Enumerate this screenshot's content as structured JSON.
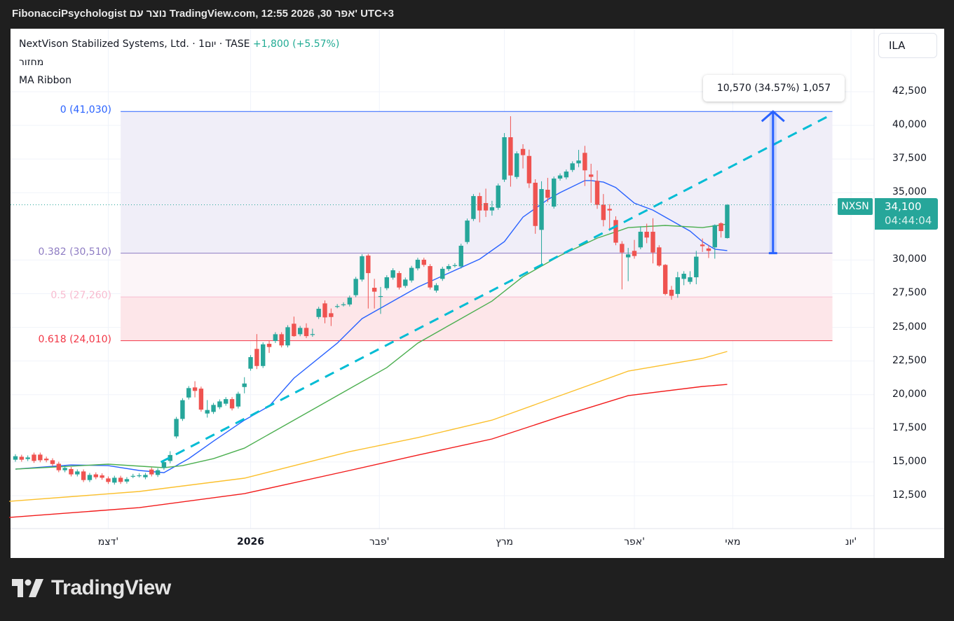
{
  "header": {
    "text": "FibonacciPsychologist נוצר עם TradingView.com, 12:55 2026 ,30 אפר' UTC+3"
  },
  "legend": {
    "symbol_line": "NextVison Stabilized Systems, Ltd. · 1יום · TASE",
    "change": "+1,800 (+5.57%)",
    "indicator_volume": "מחזור",
    "indicator_ma": "MA Ribbon"
  },
  "currency": "ILA",
  "branding": {
    "logo_text": "TradingView"
  },
  "price_badge": {
    "symbol": "NXSN",
    "price": "34,100",
    "countdown": "04:44:04"
  },
  "measure": {
    "label": "10,570 (34.57%) 1,057",
    "from": 30510,
    "to": 41030,
    "at_index": 122.4
  },
  "chart_data": {
    "type": "candlestick",
    "title": "NextVison Stabilized Systems, Ltd. · 1D · TASE",
    "ylim": [
      9800,
      45500
    ],
    "y_ticks": [
      "42,500",
      "40,000",
      "37,500",
      "35,000",
      "30,000",
      "27,500",
      "25,000",
      "22,500",
      "20,000",
      "17,500",
      "15,000",
      "12,500"
    ],
    "y_tick_values": [
      42500,
      40000,
      37500,
      35000,
      30000,
      27500,
      25000,
      22500,
      20000,
      17500,
      15000,
      12500
    ],
    "x_ticks": [
      {
        "label": "דצמ'",
        "index": 15,
        "bold": false
      },
      {
        "label": "2026",
        "index": 38,
        "bold": true
      },
      {
        "label": "פבר'",
        "index": 58.8,
        "bold": false
      },
      {
        "label": "מרץ",
        "index": 79,
        "bold": false
      },
      {
        "label": "אפר'",
        "index": 100,
        "bold": false
      },
      {
        "label": "מאי",
        "index": 115.9,
        "bold": false
      },
      {
        "label": "יונ'",
        "index": 135,
        "bold": false
      }
    ],
    "last_price": 34100,
    "candles_format": "[open, close, high?, low?]",
    "candles": [
      [
        15170,
        15430
      ],
      [
        15390,
        15170
      ],
      [
        15220,
        15340
      ],
      [
        15550,
        15080
      ],
      [
        15550,
        15130
      ],
      [
        15250,
        15130
      ],
      [
        15130,
        14850
      ],
      [
        14870,
        14390
      ],
      [
        14390,
        14560
      ],
      [
        14480,
        14080
      ],
      [
        14080,
        14300
      ],
      [
        14300,
        13660
      ],
      [
        13660,
        14040
      ],
      [
        14080,
        13870
      ],
      [
        14010,
        13830
      ],
      [
        13780,
        13520
      ],
      [
        13470,
        13830
      ],
      [
        13830,
        13520
      ],
      [
        13550,
        13730
      ],
      [
        13950,
        13970
      ],
      [
        14000,
        14010
      ],
      [
        13870,
        14040
      ],
      [
        14440,
        14080
      ],
      [
        14040,
        14390
      ],
      [
        14560,
        14990
      ],
      [
        15080,
        15520,
        15800,
        14900
      ],
      [
        16900,
        18200
      ],
      [
        18200,
        19590
      ],
      [
        19790,
        20490
      ],
      [
        20540,
        20280,
        21000,
        19800
      ],
      [
        20450,
        18890
      ],
      [
        18600,
        18860,
        19600,
        18300
      ],
      [
        18720,
        19240
      ],
      [
        19070,
        19500
      ],
      [
        19330,
        19670
      ],
      [
        19670,
        18980
      ],
      [
        19120,
        20070
      ],
      [
        20570,
        20830,
        21300,
        20100
      ],
      [
        21930,
        22790
      ],
      [
        23400,
        22130,
        24500,
        21900
      ],
      [
        22130,
        23740
      ],
      [
        23780,
        23540,
        24000,
        23100
      ],
      [
        23990,
        24490
      ],
      [
        24490,
        23660
      ],
      [
        23660,
        25010
      ],
      [
        25270,
        24350,
        25800,
        24300
      ],
      [
        24490,
        24960
      ],
      [
        24960,
        24350,
        25300,
        24200
      ],
      [
        24490,
        24500,
        24900,
        24300
      ],
      [
        25770,
        26380
      ],
      [
        26780,
        25740,
        27000,
        25300
      ],
      [
        26050,
        25770,
        26400,
        25100
      ],
      [
        26570,
        26580
      ],
      [
        26700,
        26710
      ],
      [
        26700,
        27210
      ],
      [
        27390,
        28600
      ],
      [
        28550,
        30280
      ],
      [
        30330,
        29030,
        30450,
        26400
      ],
      [
        27940,
        27650,
        28600,
        26400
      ],
      [
        27300,
        27320,
        28000,
        26000
      ],
      [
        27910,
        28720
      ],
      [
        28690,
        29240
      ],
      [
        29030,
        27960
      ],
      [
        28080,
        28550
      ],
      [
        28480,
        29420
      ],
      [
        29380,
        30020
      ],
      [
        30020,
        29640
      ],
      [
        29550,
        27960
      ],
      [
        27730,
        28130
      ],
      [
        28600,
        29350
      ],
      [
        29330,
        29550
      ],
      [
        29600,
        29620
      ],
      [
        29520,
        31060
      ],
      [
        31340,
        32930
      ],
      [
        33050,
        34750
      ],
      [
        34750,
        33680,
        35000,
        32800
      ],
      [
        34230,
        33680,
        35300,
        33200
      ],
      [
        33680,
        33920,
        34400,
        33300
      ],
      [
        33880,
        35530
      ],
      [
        35970,
        39120,
        39430,
        35800
      ],
      [
        39120,
        36280,
        40680,
        35450
      ],
      [
        36170,
        37920
      ],
      [
        38250,
        37790,
        38600,
        36800
      ],
      [
        37730,
        35700,
        38200,
        35350
      ],
      [
        35740,
        32530,
        36000,
        31950
      ],
      [
        32240,
        35270,
        35850,
        29550
      ],
      [
        35220,
        34620,
        36100,
        34300
      ],
      [
        33970,
        36050
      ],
      [
        36050,
        36280
      ],
      [
        36140,
        36570
      ],
      [
        36690,
        37180
      ],
      [
        37180,
        37390,
        38180,
        36900
      ],
      [
        37960,
        36660,
        38480,
        35500
      ],
      [
        36350,
        36180,
        37150,
        34250
      ],
      [
        35880,
        34100,
        36650,
        33800
      ],
      [
        34110,
        32970,
        34900,
        32500
      ],
      [
        33800,
        33680,
        34150,
        32300
      ],
      [
        32970,
        31290,
        33250,
        31100
      ],
      [
        31200,
        30560,
        31400,
        27820
      ],
      [
        30200,
        30420,
        30900,
        28430
      ],
      [
        30680,
        30300,
        31500,
        30100
      ],
      [
        30940,
        32100,
        32500,
        30800
      ],
      [
        32100,
        31670,
        32700,
        31250
      ],
      [
        32100,
        30560,
        33100,
        29750
      ],
      [
        30940,
        29590,
        31100,
        29500
      ],
      [
        29640,
        27480,
        29700,
        27380
      ],
      [
        27790,
        27340,
        28080,
        27050
      ],
      [
        27480,
        28720,
        29120,
        27200
      ],
      [
        28600,
        28980,
        29170,
        28130
      ],
      [
        28380,
        28720,
        29170,
        28200
      ],
      [
        28720,
        30250,
        30680,
        28200
      ],
      [
        31150,
        31030,
        31600,
        30600
      ],
      [
        30860,
        30680,
        31100,
        30150
      ],
      [
        30940,
        32590,
        32650,
        30100
      ],
      [
        32730,
        32150,
        32800,
        31670
      ],
      [
        31630,
        34100,
        34150,
        31600
      ]
    ],
    "moving_averages": [
      {
        "name": "MA short",
        "color": "#2962ff",
        "points": [
          [
            0,
            14470
          ],
          [
            9,
            14780
          ],
          [
            15,
            14730
          ],
          [
            20,
            14370
          ],
          [
            24,
            14210
          ],
          [
            28,
            15250
          ],
          [
            32,
            16550
          ],
          [
            37,
            18110
          ],
          [
            41,
            19150
          ],
          [
            45,
            21230
          ],
          [
            52,
            23830
          ],
          [
            56,
            25650
          ],
          [
            61,
            26950
          ],
          [
            65,
            27990
          ],
          [
            70,
            29030
          ],
          [
            75,
            30070
          ],
          [
            79,
            31370
          ],
          [
            82,
            33190
          ],
          [
            86,
            34490
          ],
          [
            88,
            35010
          ],
          [
            92,
            35900
          ],
          [
            93,
            35900
          ],
          [
            95,
            35790
          ],
          [
            97,
            35380
          ],
          [
            100,
            34230
          ],
          [
            103,
            33710
          ],
          [
            105,
            33190
          ],
          [
            109,
            32150
          ],
          [
            111,
            31370
          ],
          [
            113,
            30800
          ],
          [
            115,
            30700
          ]
        ]
      },
      {
        "name": "MA medium",
        "color": "#4caf50",
        "points": [
          [
            0,
            14470
          ],
          [
            15,
            14840
          ],
          [
            24,
            14580
          ],
          [
            27,
            14730
          ],
          [
            32,
            15250
          ],
          [
            37,
            16030
          ],
          [
            43,
            17590
          ],
          [
            49,
            19150
          ],
          [
            54,
            20450
          ],
          [
            60,
            22010
          ],
          [
            65,
            23830
          ],
          [
            71,
            25390
          ],
          [
            77,
            26950
          ],
          [
            82,
            28770
          ],
          [
            88,
            30330
          ],
          [
            94,
            31630
          ],
          [
            99,
            32410
          ],
          [
            105,
            32570
          ],
          [
            111,
            32410
          ],
          [
            115,
            32670
          ]
        ]
      },
      {
        "name": "MA long",
        "color": "#fbc02d",
        "points": [
          [
            -1,
            12080
          ],
          [
            20,
            12810
          ],
          [
            37,
            13800
          ],
          [
            54,
            15770
          ],
          [
            65,
            16810
          ],
          [
            77,
            18110
          ],
          [
            88,
            19930
          ],
          [
            99,
            21750
          ],
          [
            111,
            22690
          ],
          [
            115,
            23210
          ]
        ]
      },
      {
        "name": "MA longest",
        "color": "#f21b1b",
        "points": [
          [
            -1,
            10880
          ],
          [
            20,
            11610
          ],
          [
            37,
            12650
          ],
          [
            54,
            14370
          ],
          [
            65,
            15510
          ],
          [
            77,
            16710
          ],
          [
            88,
            18370
          ],
          [
            99,
            19930
          ],
          [
            111,
            20610
          ],
          [
            115,
            20760
          ]
        ]
      }
    ],
    "trend_line": {
      "color": "#00bcd4",
      "from": [
        23.5,
        14990
      ],
      "to": [
        132,
        40840
      ]
    },
    "fibonacci": {
      "start_index": 17,
      "end_index": 132,
      "levels": [
        {
          "ratio": "0",
          "price": 41030,
          "label": "0 (41,030)",
          "color": "#2962ff",
          "fill": "#f0eef8"
        },
        {
          "ratio": "0.382",
          "price": 30510,
          "label": "0.382 (30,510)",
          "color": "#8e7cc3",
          "fill": "#fcf5f8"
        },
        {
          "ratio": "0.5",
          "price": 27260,
          "label": "0.5 (27,260)",
          "color": "#f8bbd0",
          "fill": "#fde6e9"
        },
        {
          "ratio": "0.618",
          "price": 24010,
          "label": "0.618 (24,010)",
          "color": "#f23645",
          "fill": null
        }
      ]
    },
    "colors": {
      "up": "#26a69a",
      "down": "#ef5350",
      "measure": "#2962ff"
    }
  }
}
